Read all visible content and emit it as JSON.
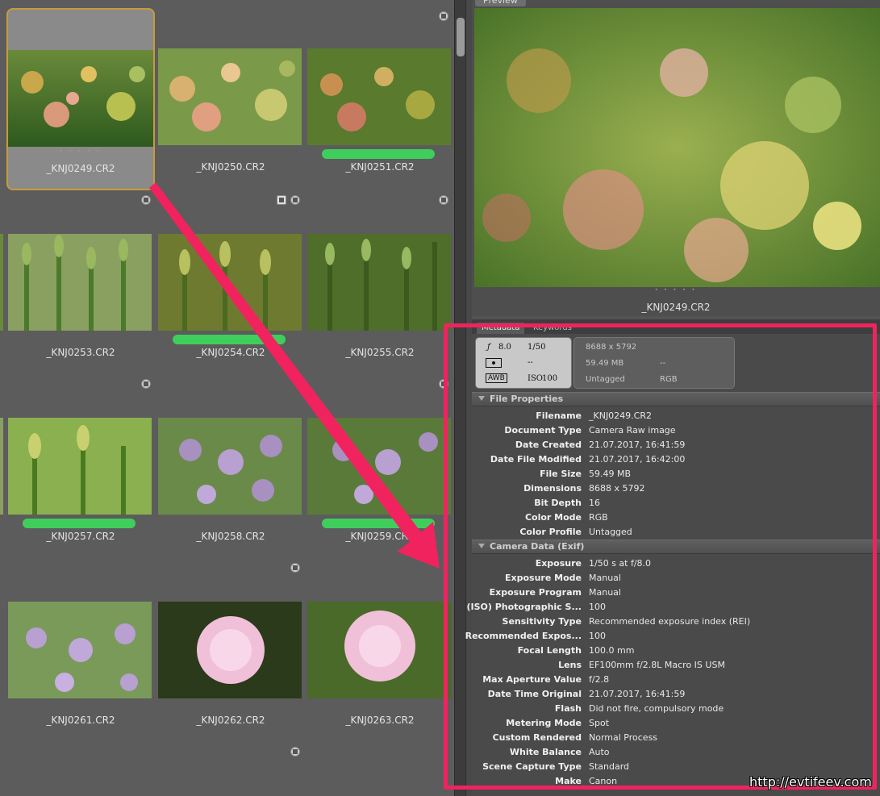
{
  "thumbnails": [
    {
      "file": "_KNJ0249.CR2",
      "selected": true,
      "label_color": ""
    },
    {
      "file": "_KNJ0250.CR2",
      "selected": false,
      "label_color": ""
    },
    {
      "file": "_KNJ0251.CR2",
      "selected": false,
      "label_color": "#3fce5c"
    },
    {
      "file": "_KNJ0253.CR2",
      "selected": false,
      "label_color": ""
    },
    {
      "file": "_KNJ0254.CR2",
      "selected": false,
      "label_color": "#3fce5c"
    },
    {
      "file": "_KNJ0255.CR2",
      "selected": false,
      "label_color": ""
    },
    {
      "file": "_KNJ0257.CR2",
      "selected": false,
      "label_color": "#3fce5c"
    },
    {
      "file": "_KNJ0258.CR2",
      "selected": false,
      "label_color": ""
    },
    {
      "file": "_KNJ0259.CR2",
      "selected": false,
      "label_color": "#3fce5c"
    },
    {
      "file": "_KNJ0261.CR2",
      "selected": false,
      "label_color": ""
    },
    {
      "file": "_KNJ0262.CR2",
      "selected": false,
      "label_color": ""
    },
    {
      "file": "_KNJ0263.CR2",
      "selected": false,
      "label_color": ""
    }
  ],
  "preview": {
    "tab": "Preview",
    "filename": "_KNJ0249.CR2"
  },
  "metadata_panel": {
    "tabs": [
      "Metadata",
      "Keywords"
    ],
    "placard": {
      "aperture": "8.0",
      "shutter": "1/50",
      "metering": "--",
      "wb": "AWB",
      "iso": "100",
      "dimensions": "8688 x 5792",
      "file_size": "59.49 MB",
      "dash": "--",
      "color_profile": "Untagged",
      "color_mode": "RGB"
    },
    "file_properties": {
      "title": "File Properties",
      "rows": [
        {
          "k": "Filename",
          "v": "_KNJ0249.CR2"
        },
        {
          "k": "Document Type",
          "v": "Camera Raw image"
        },
        {
          "k": "Date Created",
          "v": "21.07.2017, 16:41:59"
        },
        {
          "k": "Date File Modified",
          "v": "21.07.2017, 16:42:00"
        },
        {
          "k": "File Size",
          "v": "59.49 MB"
        },
        {
          "k": "Dimensions",
          "v": "8688 x 5792"
        },
        {
          "k": "Bit Depth",
          "v": "16"
        },
        {
          "k": "Color Mode",
          "v": "RGB"
        },
        {
          "k": "Color Profile",
          "v": "Untagged"
        }
      ]
    },
    "camera_data": {
      "title": "Camera Data (Exif)",
      "rows": [
        {
          "k": "Exposure",
          "v": "1/50 s at f/8.0"
        },
        {
          "k": "Exposure Mode",
          "v": "Manual"
        },
        {
          "k": "Exposure Program",
          "v": "Manual"
        },
        {
          "k": "(ISO) Photographic S...",
          "v": "100"
        },
        {
          "k": "Sensitivity Type",
          "v": "Recommended exposure index (REI)"
        },
        {
          "k": "Recommended Expos...",
          "v": "100"
        },
        {
          "k": "Focal Length",
          "v": "100.0 mm"
        },
        {
          "k": "Lens",
          "v": "EF100mm f/2.8L Macro IS USM"
        },
        {
          "k": "Max Aperture Value",
          "v": "f/2.8"
        },
        {
          "k": "Date Time Original",
          "v": "21.07.2017, 16:41:59"
        },
        {
          "k": "Flash",
          "v": "Did not fire, compulsory mode"
        },
        {
          "k": "Metering Mode",
          "v": "Spot"
        },
        {
          "k": "Custom Rendered",
          "v": "Normal Process"
        },
        {
          "k": "White Balance",
          "v": "Auto"
        },
        {
          "k": "Scene Capture Type",
          "v": "Standard"
        },
        {
          "k": "Make",
          "v": "Canon"
        }
      ]
    }
  },
  "watermark": "http://evtifeev.com",
  "colors": {
    "highlight": "#f0235f",
    "label_green": "#3fce5c",
    "selection": "#c89a3c"
  }
}
